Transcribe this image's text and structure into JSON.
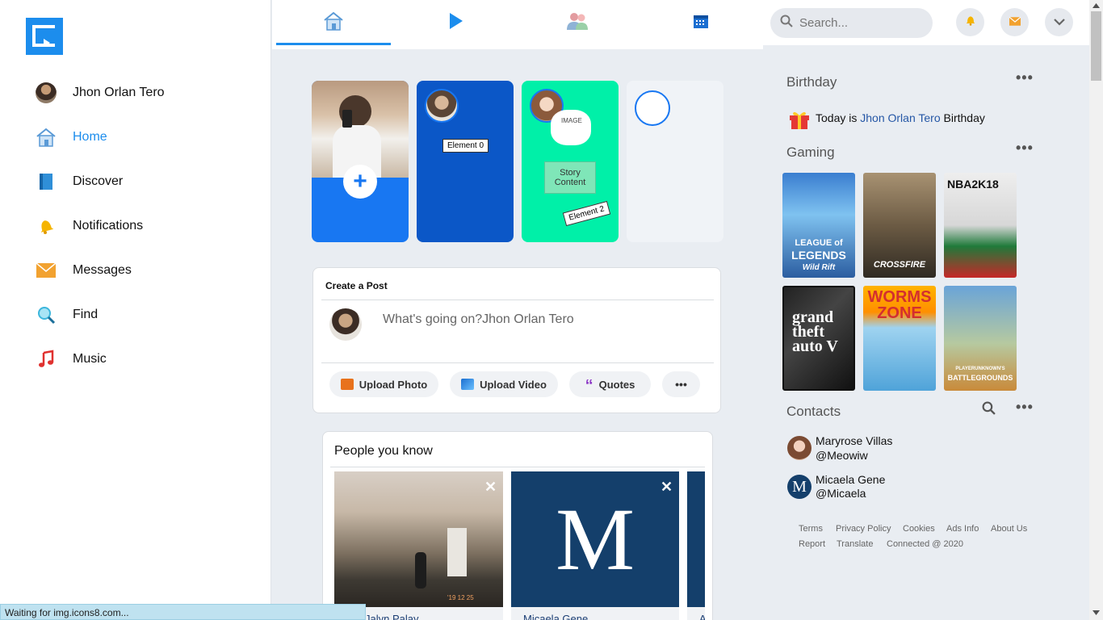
{
  "sidebar": {
    "user_name": "Jhon Orlan Tero",
    "items": [
      {
        "label": "Home",
        "icon": "home-icon",
        "active": true
      },
      {
        "label": "Discover",
        "icon": "book-icon"
      },
      {
        "label": "Notifications",
        "icon": "bell-icon"
      },
      {
        "label": "Messages",
        "icon": "envelope-icon"
      },
      {
        "label": "Find",
        "icon": "magnifier-icon"
      },
      {
        "label": "Music",
        "icon": "music-note-icon"
      }
    ]
  },
  "topnav": {
    "tabs": [
      {
        "icon": "home-icon",
        "active": true
      },
      {
        "icon": "play-icon"
      },
      {
        "icon": "friends-icon"
      },
      {
        "icon": "calendar-icon"
      }
    ]
  },
  "header": {
    "search_placeholder": "Search..."
  },
  "stories": {
    "story2": {
      "element_label": "Element 0"
    },
    "story3": {
      "image_label": "IMAGE",
      "content_line1": "Story",
      "content_line2": "Content",
      "element_label": "Element 2"
    }
  },
  "create_post": {
    "title": "Create a Post",
    "placeholder": "What's going on?Jhon Orlan Tero",
    "buttons": {
      "photo": "Upload Photo",
      "video": "Upload Video",
      "quotes": "Quotes",
      "more": "•••"
    }
  },
  "people_you_know": {
    "title": "People you know",
    "people": [
      {
        "name": "Jalyn Palay",
        "photo_caption": "'19 12 25"
      },
      {
        "name": "Micaela Gene",
        "monogram": "M"
      },
      {
        "name": "A"
      }
    ]
  },
  "birthday": {
    "title": "Birthday",
    "text_prefix": "Today is",
    "name": "Jhon Orlan Tero",
    "text_suffix": "Birthday"
  },
  "gaming": {
    "title": "Gaming",
    "games": [
      {
        "line1": "LEAGUE of",
        "line2": "LEGENDS",
        "line3": "Wild Rift"
      },
      {
        "line1": "CROSSFIRE"
      },
      {
        "line1": "NBA2K18"
      },
      {
        "line1": "grand",
        "line2": "theft",
        "line3": "auto V"
      },
      {
        "line1": "WORMS",
        "line2": "ZONE"
      },
      {
        "line1": "PLAYERUNKNOWN'S",
        "line2": "BATTLEGROUNDS"
      }
    ]
  },
  "contacts": {
    "title": "Contacts",
    "list": [
      {
        "name": "Maryrose Villas",
        "handle": "@Meowiw"
      },
      {
        "name": "Micaela Gene",
        "handle": "@Micaela",
        "monogram": "M"
      }
    ]
  },
  "footer": {
    "links": [
      "Terms",
      "Privacy Policy",
      "Cookies",
      "Ads Info",
      "About Us",
      "Report",
      "Translate",
      "Connected @ 2020"
    ]
  },
  "status_bar": "Waiting for img.icons8.com...",
  "colors": {
    "accent": "#1c8ded",
    "story_blue": "#0b57c7",
    "story_green": "#00f0a8",
    "brand_dark": "#143f6b"
  }
}
